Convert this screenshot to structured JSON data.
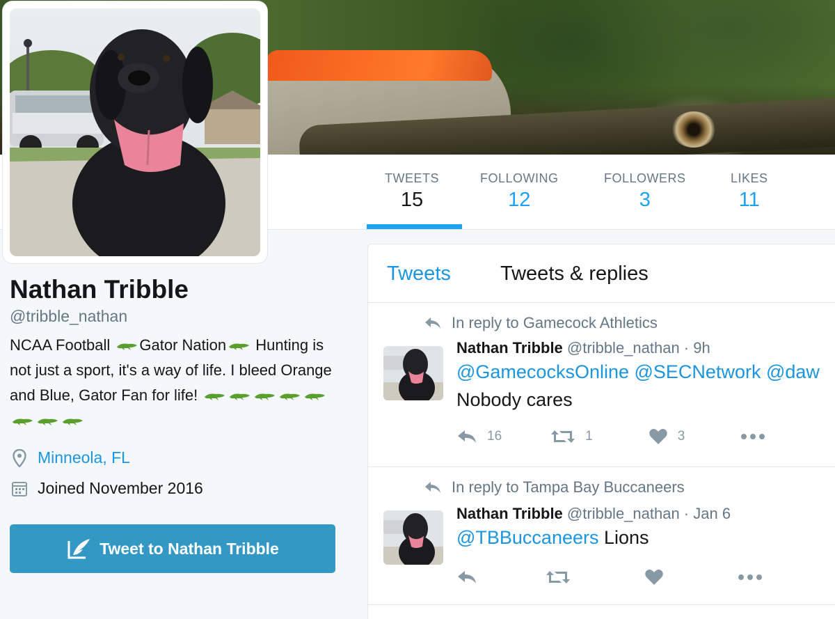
{
  "profile": {
    "name": "Nathan Tribble",
    "handle": "@tribble_nathan",
    "bio_line1_a": "NCAA Football ",
    "bio_line1_b": "Gator Nation",
    "bio_rest": "Hunting is not just a sport, it's a way of life. I bleed Orange and Blue, Gator Fan for life! ",
    "location": "Minneola, FL",
    "joined": "Joined November 2016",
    "tweet_to_label": "Tweet to Nathan Tribble"
  },
  "nav": {
    "items": [
      {
        "label": "TWEETS",
        "value": "15"
      },
      {
        "label": "FOLLOWING",
        "value": "12"
      },
      {
        "label": "FOLLOWERS",
        "value": "3"
      },
      {
        "label": "LIKES",
        "value": "11"
      }
    ]
  },
  "timeline": {
    "tabs": [
      "Tweets",
      "Tweets & replies"
    ],
    "tweets": [
      {
        "reply_to": "In reply to Gamecock Athletics",
        "name": "Nathan Tribble",
        "meta": "@tribble_nathan · 9h",
        "mentions": "@GamecocksOnline @SECNetwork @daw",
        "text": "Nobody cares",
        "reply_count": "16",
        "retweet_count": "1",
        "like_count": "3"
      },
      {
        "reply_to": "In reply to Tampa Bay Buccaneers",
        "name": "Nathan Tribble",
        "meta": "@tribble_nathan · Jan 6",
        "mentions": "@TBBuccaneers",
        "text": " Lions",
        "reply_count": "",
        "retweet_count": "",
        "like_count": ""
      }
    ]
  },
  "colors": {
    "accent": "#1da1f2",
    "link": "#1b95e0",
    "button": "#3498c5",
    "muted": "#657786"
  }
}
